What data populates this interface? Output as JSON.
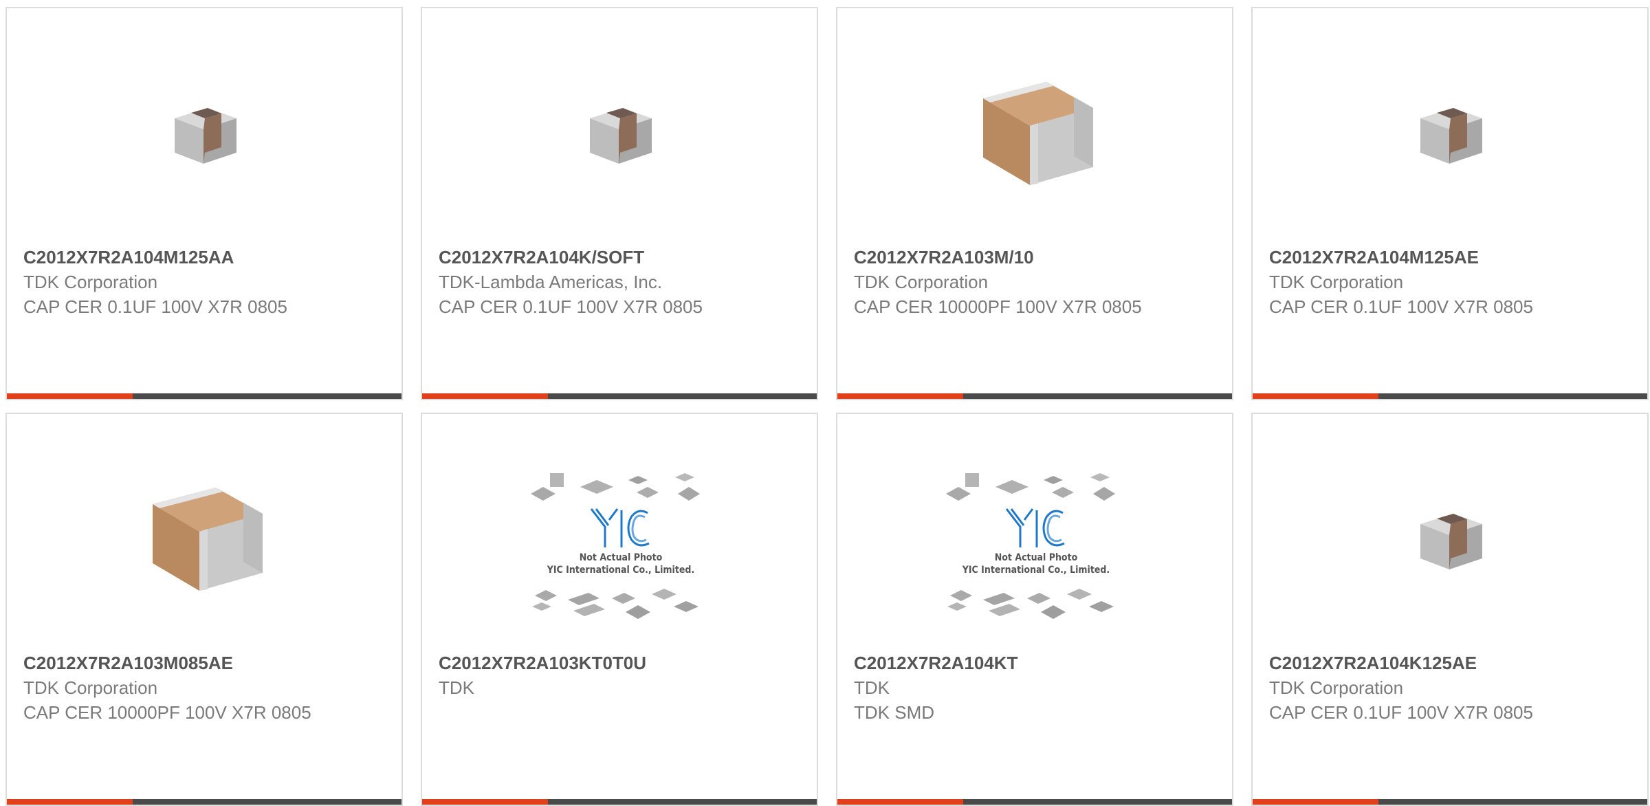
{
  "products": [
    {
      "part": "C2012X7R2A104M125AA",
      "manufacturer": "TDK Corporation",
      "description": "CAP CER 0.1UF 100V X7R 0805",
      "image": "small-capacitor"
    },
    {
      "part": "C2012X7R2A104K/SOFT",
      "manufacturer": "TDK-Lambda Americas, Inc.",
      "description": "CAP CER 0.1UF 100V X7R 0805",
      "image": "small-capacitor"
    },
    {
      "part": "C2012X7R2A103M/10",
      "manufacturer": "TDK Corporation",
      "description": "CAP CER 10000PF 100V X7R 0805",
      "image": "large-capacitor"
    },
    {
      "part": "C2012X7R2A104M125AE",
      "manufacturer": "TDK Corporation",
      "description": "CAP CER 0.1UF 100V X7R 0805",
      "image": "small-capacitor"
    },
    {
      "part": "C2012X7R2A103M085AE",
      "manufacturer": "TDK Corporation",
      "description": "CAP CER 10000PF 100V X7R 0805",
      "image": "large-capacitor"
    },
    {
      "part": "C2012X7R2A103KT0T0U",
      "manufacturer": "TDK",
      "description": "",
      "image": "placeholder"
    },
    {
      "part": "C2012X7R2A104KT",
      "manufacturer": "TDK",
      "description": "TDK SMD",
      "image": "placeholder"
    },
    {
      "part": "C2012X7R2A104K125AE",
      "manufacturer": "TDK Corporation",
      "description": "CAP CER 0.1UF 100V X7R 0805",
      "image": "small-capacitor"
    }
  ],
  "placeholder": {
    "logo": "YIC",
    "line1": "Not Actual Photo",
    "line2": "YIC International Co., Limited."
  },
  "colors": {
    "accent": "#e2401b",
    "bar": "#4a4a4a",
    "border": "#dcdcdc",
    "part_text": "#555555",
    "body_text": "#7a7a7a",
    "logo_blue": "#1f78c8"
  }
}
